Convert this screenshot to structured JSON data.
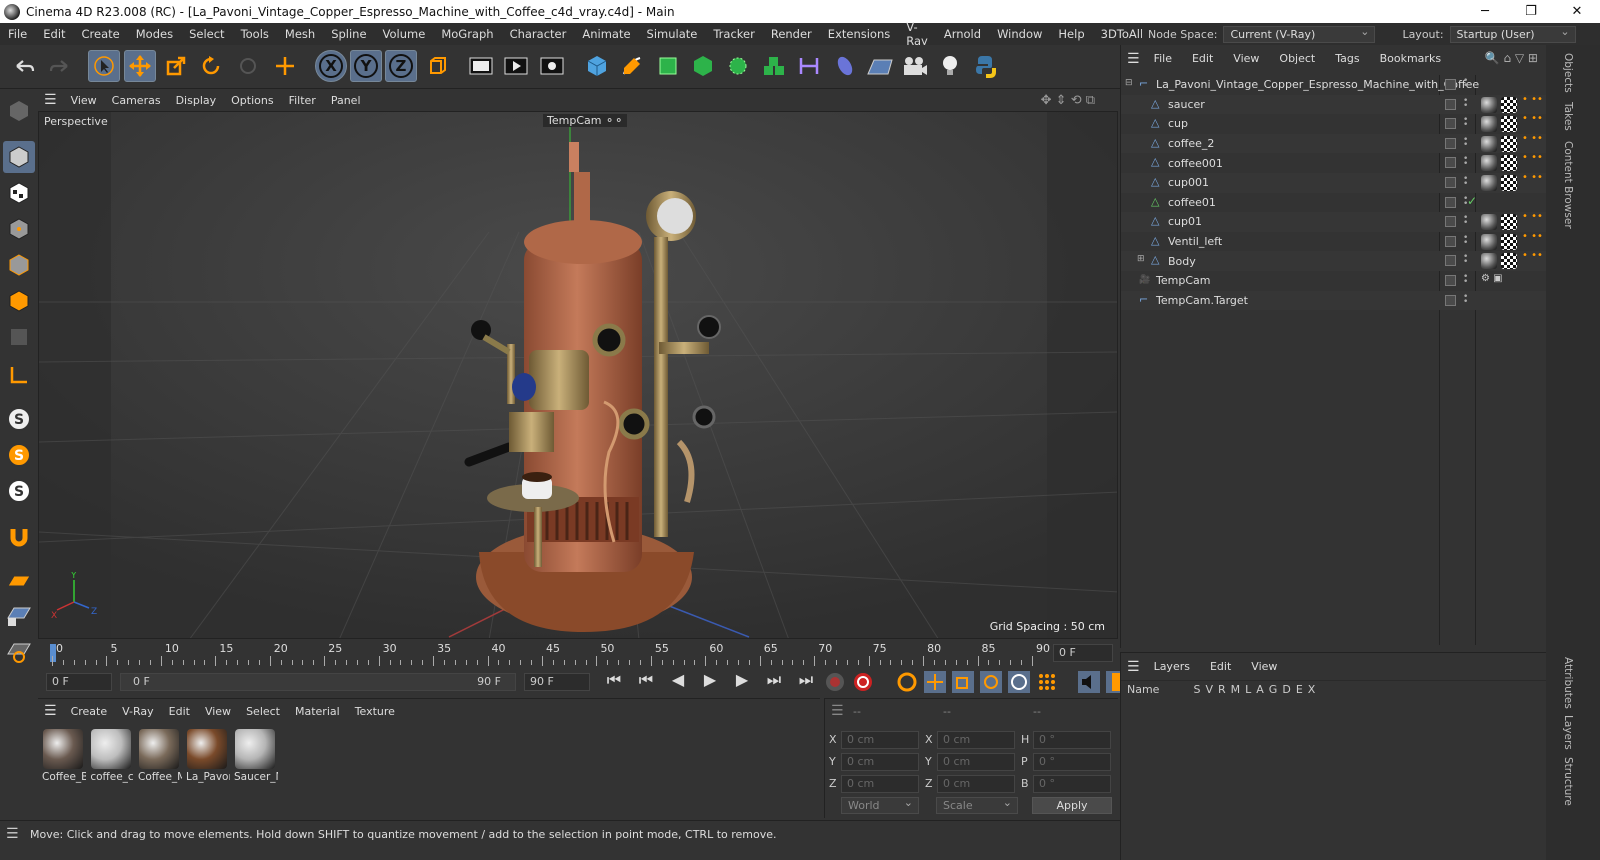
{
  "title_bar": {
    "title": "Cinema 4D R23.008 (RC) - [La_Pavoni_Vintage_Copper_Espresso_Machine_with_Coffee_c4d_vray.c4d] - Main"
  },
  "menu": [
    "File",
    "Edit",
    "Create",
    "Modes",
    "Select",
    "Tools",
    "Mesh",
    "Spline",
    "Volume",
    "MoGraph",
    "Character",
    "Animate",
    "Simulate",
    "Tracker",
    "Render",
    "Extensions",
    "V-Ray",
    "Arnold",
    "Window",
    "Help",
    "3DToAll"
  ],
  "node_space": {
    "label": "Node Space:",
    "value": "Current (V-Ray)"
  },
  "layout": {
    "label": "Layout:",
    "value": "Startup (User)"
  },
  "toolbar_axes": [
    "X",
    "Y",
    "Z"
  ],
  "viewport": {
    "menu": [
      "View",
      "Cameras",
      "Display",
      "Options",
      "Filter",
      "Panel"
    ],
    "label": "Perspective",
    "camera": "TempCam",
    "grid_spacing": "Grid Spacing : 50 cm",
    "axis_labels": {
      "x": "X",
      "y": "Y",
      "z": "Z"
    }
  },
  "timeline": {
    "ticks": [
      "0",
      "5",
      "10",
      "15",
      "20",
      "25",
      "30",
      "35",
      "40",
      "45",
      "50",
      "55",
      "60",
      "65",
      "70",
      "75",
      "80",
      "85",
      "90"
    ],
    "current_frame": "0 F",
    "start": "0 F",
    "range_start": "0 F",
    "range_end": "90 F",
    "end": "90 F"
  },
  "materials": {
    "menu": [
      "Create",
      "V-Ray",
      "Edit",
      "View",
      "Select",
      "Material",
      "Texture"
    ],
    "items": [
      {
        "name": "Coffee_B",
        "color": "#6a5a50"
      },
      {
        "name": "coffee_c",
        "color": "#bdbdbd"
      },
      {
        "name": "Coffee_M",
        "color": "#7a6a5a"
      },
      {
        "name": "La_Pavor",
        "color": "#7a4a2a"
      },
      {
        "name": "Saucer_M",
        "color": "#b5b5b5"
      }
    ]
  },
  "coords": {
    "headers": [
      "--",
      "--",
      "--"
    ],
    "rows": [
      {
        "a": "X",
        "av": "0 cm",
        "b": "X",
        "bv": "0 cm",
        "c": "H",
        "cv": "0 °"
      },
      {
        "a": "Y",
        "av": "0 cm",
        "b": "Y",
        "bv": "0 cm",
        "c": "P",
        "cv": "0 °"
      },
      {
        "a": "Z",
        "av": "0 cm",
        "b": "Z",
        "bv": "0 cm",
        "c": "B",
        "cv": "0 °"
      }
    ],
    "world": "World",
    "scale": "Scale",
    "apply": "Apply"
  },
  "status": "Move: Click and drag to move elements. Hold down SHIFT to quantize movement / add to the selection in point mode, CTRL to remove.",
  "objects": {
    "menu": [
      "File",
      "Edit",
      "View",
      "Object",
      "Tags",
      "Bookmarks"
    ],
    "items": [
      {
        "name": "La_Pavoni_Vintage_Copper_Espresso_Machine_with_Coffee",
        "indent": 0,
        "icon": "null"
      },
      {
        "name": "saucer",
        "indent": 1,
        "icon": "poly"
      },
      {
        "name": "cup",
        "indent": 1,
        "icon": "poly"
      },
      {
        "name": "coffee_2",
        "indent": 1,
        "icon": "poly"
      },
      {
        "name": "coffee001",
        "indent": 1,
        "icon": "poly"
      },
      {
        "name": "cup001",
        "indent": 1,
        "icon": "poly"
      },
      {
        "name": "coffee01",
        "indent": 1,
        "icon": "spline"
      },
      {
        "name": "cup01",
        "indent": 1,
        "icon": "poly"
      },
      {
        "name": "Ventil_left",
        "indent": 1,
        "icon": "poly"
      },
      {
        "name": "Body",
        "indent": 1,
        "icon": "poly"
      },
      {
        "name": "TempCam",
        "indent": 0,
        "icon": "camera"
      },
      {
        "name": "TempCam.Target",
        "indent": 0,
        "icon": "null"
      }
    ]
  },
  "layers": {
    "menu": [
      "Layers",
      "Edit",
      "View"
    ],
    "columns": [
      "Name",
      "S",
      "V",
      "R",
      "M",
      "L",
      "A",
      "G",
      "D",
      "E",
      "X"
    ]
  },
  "side_tabs": [
    "Objects",
    "Takes",
    "Content Browser",
    "Attributes",
    "Layers",
    "Structure"
  ]
}
